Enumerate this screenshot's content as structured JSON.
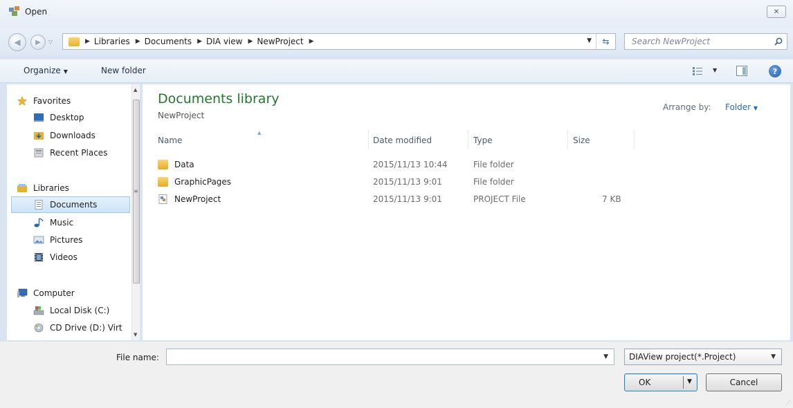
{
  "window": {
    "title": "Open",
    "close_glyph": "✕"
  },
  "navigation": {
    "breadcrumbs": [
      "Libraries",
      "Documents",
      "DIA view",
      "NewProject"
    ],
    "search_placeholder": "Search NewProject"
  },
  "toolbar": {
    "organize_label": "Organize",
    "new_folder_label": "New folder",
    "help_glyph": "?"
  },
  "sidebar": {
    "favorites_label": "Favorites",
    "favorites": [
      "Desktop",
      "Downloads",
      "Recent Places"
    ],
    "libraries_label": "Libraries",
    "libraries": [
      "Documents",
      "Music",
      "Pictures",
      "Videos"
    ],
    "selected": "Documents",
    "computer_label": "Computer",
    "computer": [
      "Local Disk (C:)",
      "CD Drive (D:) Virt"
    ]
  },
  "content": {
    "library_title": "Documents library",
    "library_subtitle": "NewProject",
    "arrange_label": "Arrange by:",
    "arrange_value": "Folder",
    "columns": {
      "name": "Name",
      "date": "Date modified",
      "type": "Type",
      "size": "Size"
    },
    "files": [
      {
        "name": "Data",
        "date": "2015/11/13 10:44",
        "type": "File folder",
        "size": "",
        "icon": "folder-icon"
      },
      {
        "name": "GraphicPages",
        "date": "2015/11/13 9:01",
        "type": "File folder",
        "size": "",
        "icon": "folder-icon"
      },
      {
        "name": "NewProject",
        "date": "2015/11/13 9:01",
        "type": "PROJECT File",
        "size": "7 KB",
        "icon": "project-file-icon"
      }
    ]
  },
  "footer": {
    "file_name_label": "File name:",
    "file_name_value": "",
    "filter_value": "DIAView project(*.Project)",
    "ok_label": "OK",
    "cancel_label": "Cancel"
  },
  "colors": {
    "library_title": "#1e7a28",
    "link_blue": "#1e6bbd",
    "selection": "#cde4f7",
    "folder": "#e8b230"
  }
}
